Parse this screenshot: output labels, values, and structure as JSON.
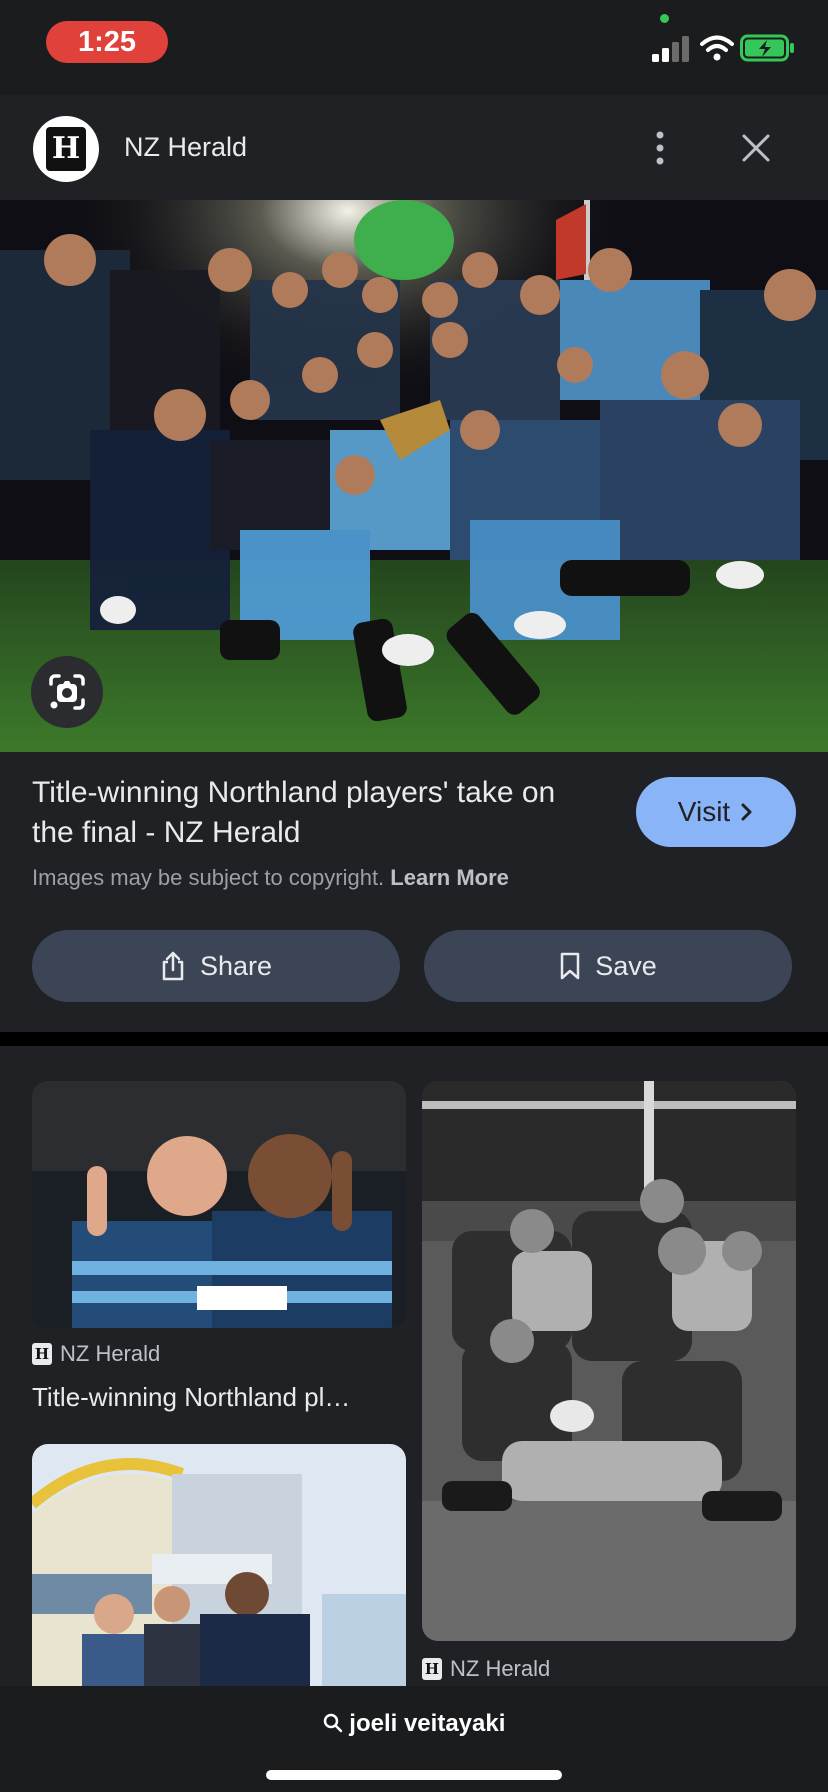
{
  "status": {
    "time": "1:25"
  },
  "source": {
    "name": "NZ Herald",
    "logo_letter": "H"
  },
  "result": {
    "title": "Title-winning Northland players' take on the final - NZ Herald",
    "visit_label": "Visit",
    "copyright_text": "Images may be subject to copyright.",
    "learn_more": "Learn More",
    "share_label": "Share",
    "save_label": "Save"
  },
  "related": [
    {
      "source": "NZ Herald",
      "title": "Title-winning Northland pl…"
    },
    {
      "source": "NZ Herald"
    }
  ],
  "search": {
    "query": "joeli veitayaki"
  },
  "icons": [
    "signal-icon",
    "wifi-icon",
    "battery-charging-icon",
    "more-vert-icon",
    "close-icon",
    "lens-icon",
    "share-icon",
    "bookmark-icon",
    "chevron-right-icon",
    "search-icon"
  ],
  "colors": {
    "visit_button": "#8ab4f8",
    "pill_button": "#3c4556",
    "time_pill": "#e0413b",
    "background": "#202124"
  }
}
